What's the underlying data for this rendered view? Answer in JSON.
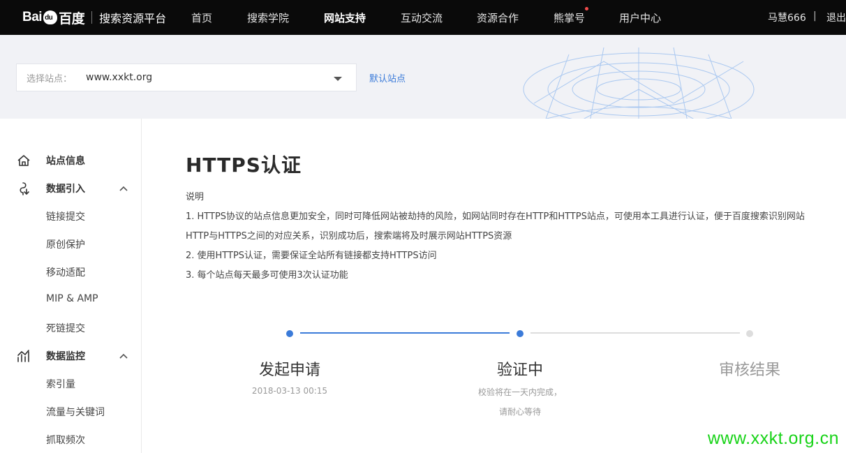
{
  "header": {
    "logo_text_left": "Bai",
    "logo_text_right": "百度",
    "platform_title": "搜索资源平台",
    "nav": [
      {
        "label": "首页"
      },
      {
        "label": "搜索学院"
      },
      {
        "label": "网站支持",
        "active": true
      },
      {
        "label": "互动交流"
      },
      {
        "label": "资源合作"
      },
      {
        "label": "熊掌号",
        "badge": true
      },
      {
        "label": "用户中心"
      }
    ],
    "username": "马慧666",
    "separator": "|",
    "logout": "退出"
  },
  "site_selector": {
    "label": "选择站点：",
    "value": "www.xxkt.org",
    "default_link": "默认站点"
  },
  "sidebar": {
    "groups": [
      {
        "label": "站点信息",
        "icon": "home-icon"
      },
      {
        "label": "数据引入",
        "icon": "data-import-icon",
        "items": [
          "链接提交",
          "原创保护",
          "移动适配",
          "MIP & AMP",
          "死链提交"
        ]
      },
      {
        "label": "数据监控",
        "icon": "chart-icon",
        "items": [
          "索引量",
          "流量与关键词",
          "抓取频次"
        ]
      }
    ]
  },
  "main": {
    "title": "HTTPS认证",
    "desc_heading": "说明",
    "desc_lines": [
      "1. HTTPS协议的站点信息更加安全，同时可降低网站被劫持的风险，如网站同时存在HTTP和HTTPS站点，可使用本工具进行认证，便于百度搜索识别网站",
      "HTTP与HTTPS之间的对应关系，识别成功后，搜索端将及时展示网站HTTPS资源",
      "2. 使用HTTPS认证，需要保证全站所有链接都支持HTTPS访问",
      "3. 每个站点每天最多可使用3次认证功能"
    ]
  },
  "steps": [
    {
      "title": "发起申请",
      "sub": [
        "2018-03-13 00:15"
      ],
      "state": "done"
    },
    {
      "title": "验证中",
      "sub": [
        "校验将在一天内完成，",
        "请耐心等待"
      ],
      "state": "current"
    },
    {
      "title": "审核结果",
      "sub": [],
      "state": "pending"
    }
  ],
  "colors": {
    "accent": "#3b7bd9",
    "topbar": "#0a0a0a",
    "band": "#f1f2f6",
    "inactive": "#dddddd",
    "watermark": "#18d318"
  },
  "watermark": "www.xxkt.org.cn"
}
